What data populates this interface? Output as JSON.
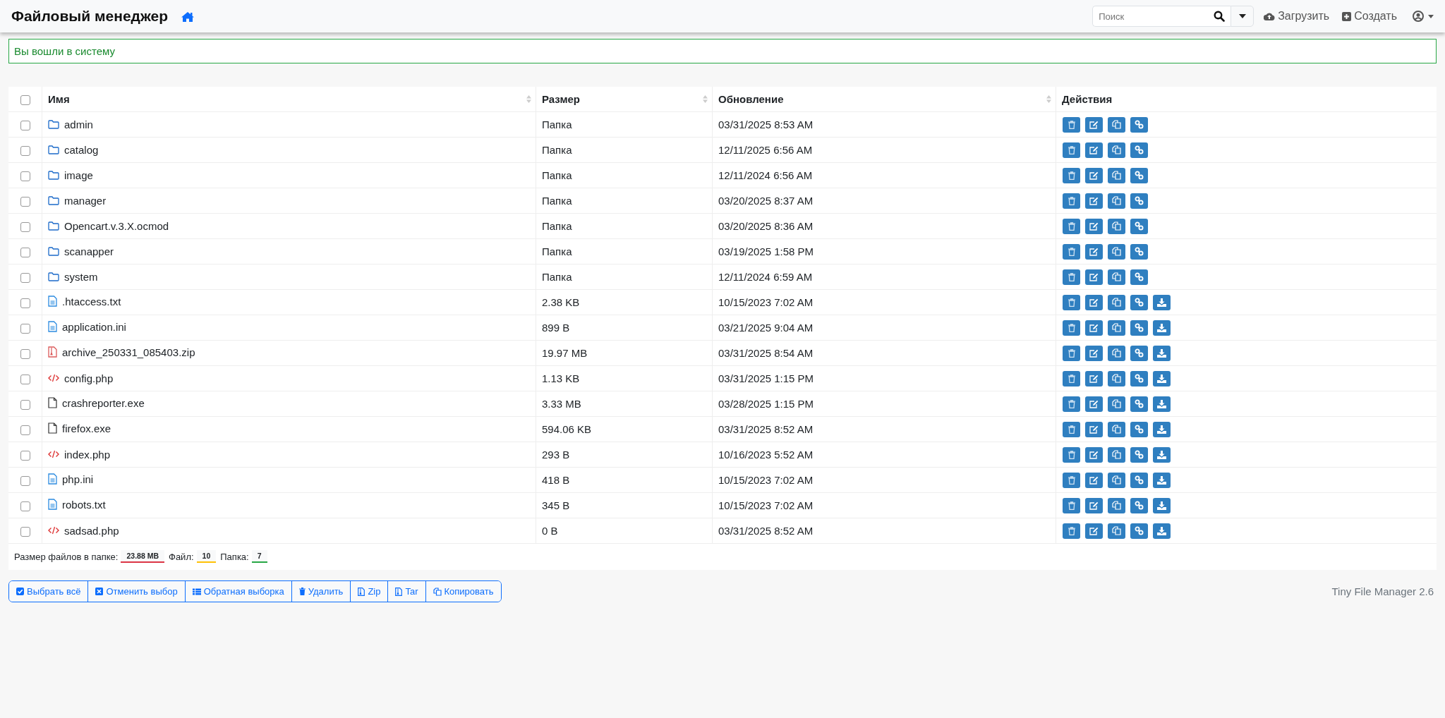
{
  "navbar": {
    "title": "Файловый менеджер",
    "search": {
      "placeholder": "Поиск"
    },
    "upload": "Загрузить",
    "create": "Создать"
  },
  "alert": {
    "text": "Вы вошли в систему"
  },
  "table": {
    "select_all": {
      "checked": false
    },
    "columns": [
      "Имя",
      "Размер",
      "Обновление",
      "Действия"
    ],
    "rows": [
      {
        "kind": "folder",
        "name": "admin",
        "size": "Папка",
        "updated": "03/31/2025 8:53 AM",
        "checked": false
      },
      {
        "kind": "folder",
        "name": "catalog",
        "size": "Папка",
        "updated": "12/11/2025 6:56 AM",
        "checked": false
      },
      {
        "kind": "folder",
        "name": "image",
        "size": "Папка",
        "updated": "12/11/2024 6:56 AM",
        "checked": false
      },
      {
        "kind": "folder",
        "name": "manager",
        "size": "Папка",
        "updated": "03/20/2025 8:37 AM",
        "checked": false
      },
      {
        "kind": "folder",
        "name": "Opencart.v.3.X.ocmod",
        "size": "Папка",
        "updated": "03/20/2025 8:36 AM",
        "checked": false
      },
      {
        "kind": "folder",
        "name": "scanapper",
        "size": "Папка",
        "updated": "03/19/2025 1:58 PM",
        "checked": false
      },
      {
        "kind": "folder",
        "name": "system",
        "size": "Папка",
        "updated": "12/11/2024 6:59 AM",
        "checked": false
      },
      {
        "kind": "text",
        "name": ".htaccess.txt",
        "size": "2.38 KB",
        "updated": "10/15/2023 7:02 AM",
        "checked": false
      },
      {
        "kind": "text",
        "name": "application.ini",
        "size": "899 B",
        "updated": "03/21/2025 9:04 AM",
        "checked": false
      },
      {
        "kind": "archive",
        "name": "archive_250331_085403.zip",
        "size": "19.97 MB",
        "updated": "03/31/2025 8:54 AM",
        "checked": false
      },
      {
        "kind": "code",
        "name": "config.php",
        "size": "1.13 KB",
        "updated": "03/31/2025 1:15 PM",
        "checked": false
      },
      {
        "kind": "file",
        "name": "crashreporter.exe",
        "size": "3.33 MB",
        "updated": "03/28/2025 1:15 PM",
        "checked": false
      },
      {
        "kind": "file",
        "name": "firefox.exe",
        "size": "594.06 KB",
        "updated": "03/31/2025 8:52 AM",
        "checked": false
      },
      {
        "kind": "code",
        "name": "index.php",
        "size": "293 B",
        "updated": "10/16/2023 5:52 AM",
        "checked": false
      },
      {
        "kind": "text",
        "name": "php.ini",
        "size": "418 B",
        "updated": "10/15/2023 7:02 AM",
        "checked": false
      },
      {
        "kind": "text",
        "name": "robots.txt",
        "size": "345 B",
        "updated": "10/15/2023 7:02 AM",
        "checked": false
      },
      {
        "kind": "code",
        "name": "sadsad.php",
        "size": "0 B",
        "updated": "03/31/2025 8:52 AM",
        "checked": false
      }
    ]
  },
  "stats": [
    {
      "label": "Размер файлов в папке:",
      "value": "23.88 MB",
      "color": "#dc3545"
    },
    {
      "label": "Файл:",
      "value": "10",
      "color": "#ffc107"
    },
    {
      "label": "Папка:",
      "value": "7",
      "color": "#28a745"
    }
  ],
  "bulk_buttons": [
    "Выбрать всё",
    "Отменить выбор",
    "Обратная выборка",
    "Удалить",
    "Zip",
    "Tar",
    "Копировать"
  ],
  "footer": "Tiny File Manager 2.6"
}
